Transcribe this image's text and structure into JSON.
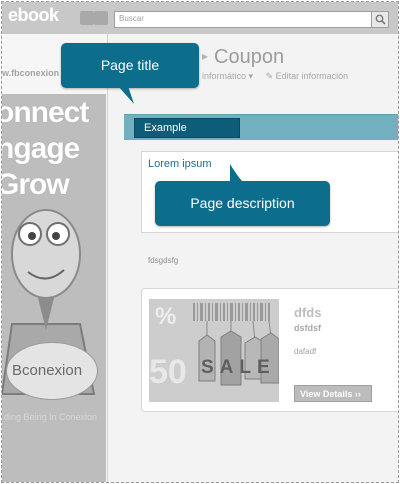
{
  "topbar": {
    "brand": "ebook",
    "search_placeholder": "Buscar"
  },
  "sidebar": {
    "url": "w.fbconexion",
    "poster_lines": [
      "onnect",
      "ngage",
      "Grow"
    ],
    "poster_bubble": "Bconexion",
    "poster_slogan": "ding Being In Conexion"
  },
  "header": {
    "title_lead": "ion",
    "separator": "▸",
    "title": "Coupon",
    "subnav_left": "informático ▾",
    "subnav_edit": "Editar información"
  },
  "tabs": [
    {
      "label": "Example"
    }
  ],
  "description": {
    "heading": "Lorem ipsum",
    "body": "fdsgdsfg"
  },
  "coupon": {
    "image_text": "SALE",
    "image_percent": "%",
    "image_number": "50",
    "title": "dfds",
    "subtitle": "dsfdsf",
    "description": "dafadf",
    "button_label": "View Details ››"
  },
  "callouts": {
    "page_title": "Page title",
    "page_description": "Page description"
  },
  "colors": {
    "accent": "#0d6d8d",
    "tab_bar": "#72b0c0",
    "link": "#1e6f91"
  }
}
